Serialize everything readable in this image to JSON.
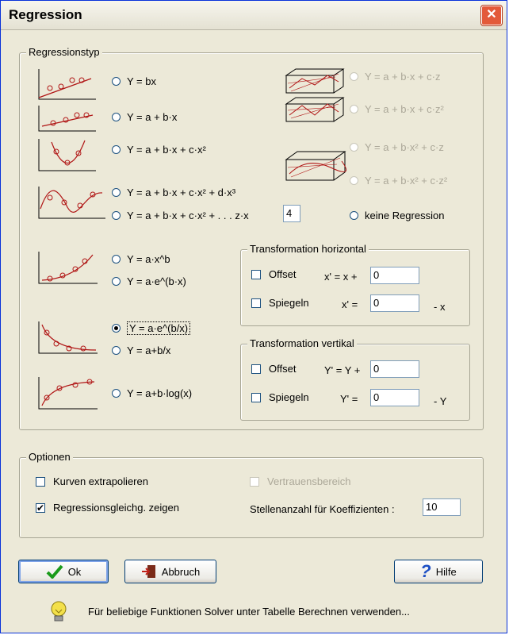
{
  "window": {
    "title": "Regression",
    "close_glyph": "✕"
  },
  "regressionstyp": {
    "legend": "Regressionstyp",
    "options": [
      {
        "label": "Y = bx",
        "selected": false,
        "enabled": true
      },
      {
        "label": "Y = a + b·x",
        "selected": false,
        "enabled": true
      },
      {
        "label": "Y = a + b·x + c·x²",
        "selected": false,
        "enabled": true
      },
      {
        "label": "Y = a + b·x + c·x² + d·x³",
        "selected": false,
        "enabled": true
      },
      {
        "label": "Y = a + b·x + c·x² + . . . z·x",
        "selected": false,
        "enabled": true
      },
      {
        "label": "Y = a·x^b",
        "selected": false,
        "enabled": true
      },
      {
        "label": "Y = a·e^(b·x)",
        "selected": false,
        "enabled": true
      },
      {
        "label": "Y = a·e^(b/x)",
        "selected": true,
        "enabled": true
      },
      {
        "label": "Y = a+b/x",
        "selected": false,
        "enabled": true
      },
      {
        "label": "Y = a+b·log(x)",
        "selected": false,
        "enabled": true
      }
    ],
    "poly_degree": "4",
    "options_3d": [
      {
        "label": "Y = a + b·x + c·z",
        "enabled": false
      },
      {
        "label": "Y = a + b·x + c·z²",
        "enabled": false
      },
      {
        "label": "Y = a + b·x² + c·z",
        "enabled": false
      },
      {
        "label": "Y = a + b·x² + c·z²",
        "enabled": false
      }
    ],
    "none_label": "keine Regression"
  },
  "transform_h": {
    "legend": "Transformation horizontal",
    "offset_label": "Offset",
    "offset_expr": "x' = x +",
    "offset_value": "0",
    "mirror_label": "Spiegeln",
    "mirror_expr": "x' =",
    "mirror_value": "0",
    "mirror_suffix": "- x"
  },
  "transform_v": {
    "legend": "Transformation vertikal",
    "offset_label": "Offset",
    "offset_expr": "Y' = Y +",
    "offset_value": "0",
    "mirror_label": "Spiegeln",
    "mirror_expr": "Y' =",
    "mirror_value": "0",
    "mirror_suffix": "- Y"
  },
  "optionen": {
    "legend": "Optionen",
    "extrapolate_label": "Kurven extrapolieren",
    "extrapolate_checked": false,
    "show_eq_label": "Regressionsgleichg. zeigen",
    "show_eq_checked": true,
    "check_glyph": "✔",
    "confidence_label": "Vertrauensbereich",
    "confidence_enabled": false,
    "digits_label": "Stellenanzahl für Koeffizienten :",
    "digits_value": "10"
  },
  "buttons": {
    "ok": "Ok",
    "cancel": "Abbruch",
    "help": "Hilfe",
    "help_glyph": "?"
  },
  "hint": "Für beliebige Funktionen Solver unter Tabelle Berechnen verwenden...",
  "colors": {
    "accent": "#0831d9",
    "curve": "#b01515",
    "axis": "#000000"
  }
}
